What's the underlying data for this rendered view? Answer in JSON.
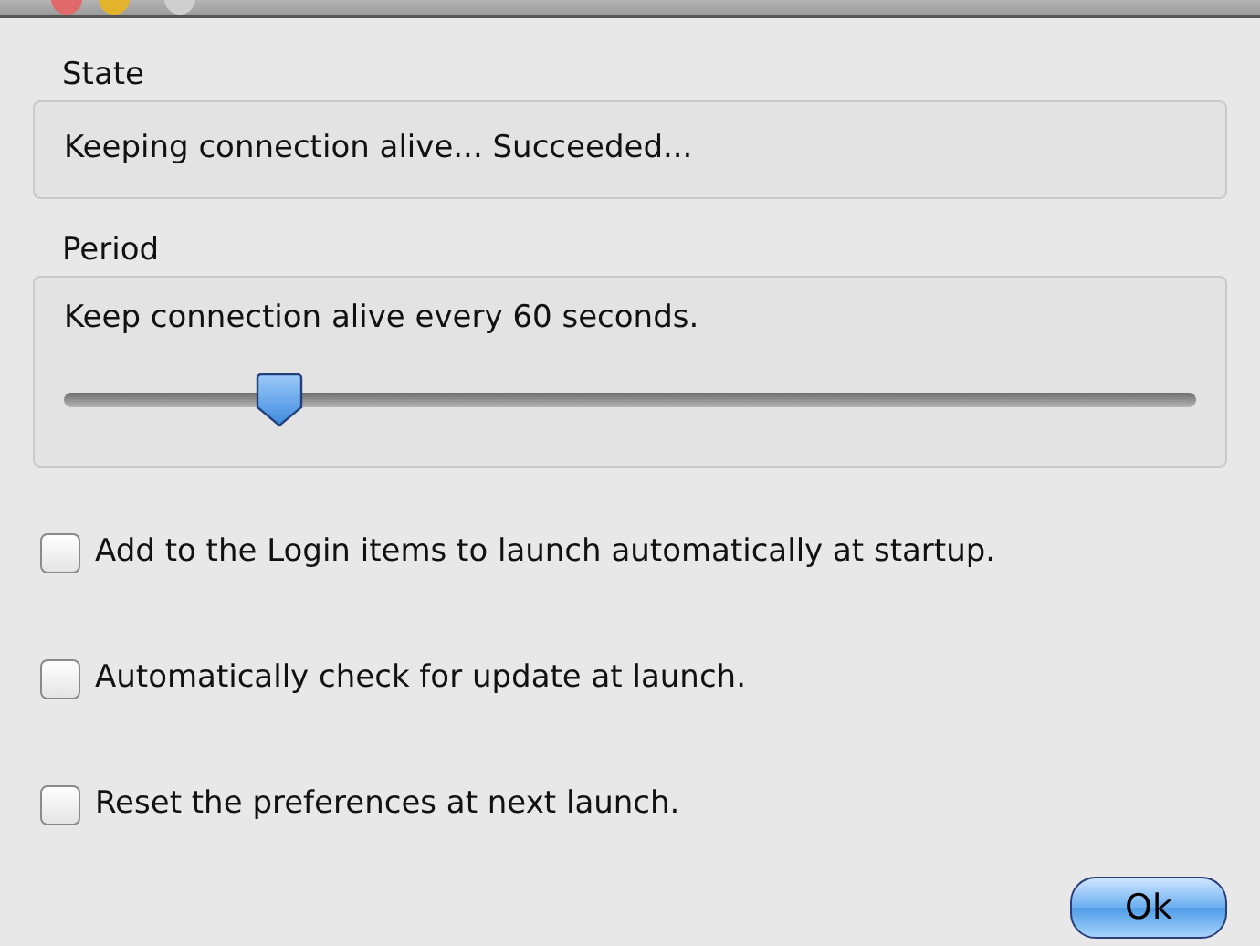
{
  "state": {
    "label": "State",
    "text": "Keeping connection alive... Succeeded..."
  },
  "period": {
    "label": "Period",
    "text": "Keep connection alive every 60 seconds.",
    "level": 0.19
  },
  "options": [
    {
      "label": "Add to the Login items to launch automatically at startup.",
      "checked": false
    },
    {
      "label": "Automatically check for update at launch.",
      "checked": false
    },
    {
      "label": "Reset the preferences at next launch.",
      "checked": false
    }
  ],
  "buttons": [
    {
      "label": "Ok",
      "default": true
    }
  ]
}
